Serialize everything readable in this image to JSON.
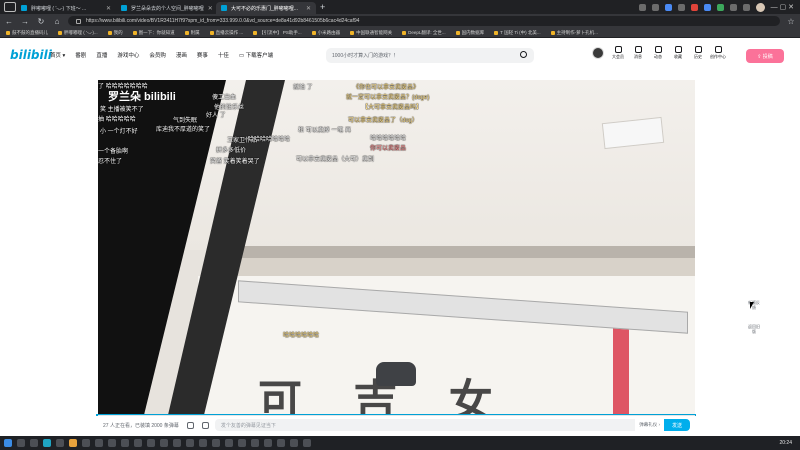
{
  "browser": {
    "tabs": [
      {
        "title": "胖嘟嘟哩 ( '-ᴗ-) 下班～ ...",
        "active": false
      },
      {
        "title": "罗兰朵朵去的个人空间_胖嘟嘟哩",
        "active": false
      },
      {
        "title": "大可不必的乐惠门_胖嘟嘟哩...",
        "active": true
      }
    ],
    "new_tab": "+",
    "url": "https://www.bilibili.com/video/BV1R3411H7f9?spm_id_from=333.999.0.0&vd_source=de8a41d92b8461505b6cac4d24caf94",
    "bookmarks": [
      "鼓不鼓的直播码儿",
      "胖嘟嘟哩 ( '-ᴗ-)...",
      "我的",
      "图一下：你就知道",
      "附属",
      "直播云操作 ...",
      "【引流中】 PS助手...",
      "小米路由器",
      "中国联通智能网关",
      "DeepL翻译: 全世...",
      "国内数据库",
      "T 国轻 Ti (中) 北美...",
      "主持制作-萝卜孔机..."
    ],
    "window_controls": "— ▢ ✕"
  },
  "bili": {
    "logo": "bilibili",
    "nav": [
      "首页 ▾",
      "番剧",
      "直播",
      "游戏中心",
      "会员购",
      "漫画",
      "赛事",
      "十佳",
      "▭ 下载客户端"
    ],
    "search_placeholder": "1000小时才算入门的游戏？！",
    "header_icons": [
      "大会员",
      "消息",
      "动态",
      "收藏",
      "历史",
      "创作中心"
    ],
    "upload_label": "⇪ 投稿"
  },
  "player": {
    "watermark": "罗兰朵 bilibili",
    "danmaku": [
      {
        "text": "了 哈哈哈哈哈哈哈",
        "style": ""
      },
      {
        "text": "笑 主播被笑不了",
        "style": ""
      },
      {
        "text": "抽 哈哈哈哈哈",
        "style": ""
      },
      {
        "text": "傻工出血",
        "style": ""
      },
      {
        "text": "他的弦乐丝",
        "style": ""
      },
      {
        "text": "好人 了",
        "style": ""
      },
      {
        "text": "气到失眠",
        "style": ""
      },
      {
        "text": "小 一个灯不好",
        "style": ""
      },
      {
        "text": "库迪我不厚道的笑了",
        "style": ""
      },
      {
        "text": "王家卫作品",
        "style": ""
      },
      {
        "text": "拼多多低价",
        "style": ""
      },
      {
        "text": "哈哈哈哈哈哈哈",
        "style": ""
      },
      {
        "text": "一个备胎啊",
        "style": ""
      },
      {
        "text": "忍不住了",
        "style": ""
      },
      {
        "text": "笑留 笑着笑着哭了",
        "style": ""
      },
      {
        "text": "《你也可以拿去卖废品》",
        "style": "ylw"
      },
      {
        "text": "【大可拿去卖废品吗】",
        "style": "ylw"
      },
      {
        "text": "就一定可以拿去卖废品？(doge)",
        "style": "ylw"
      },
      {
        "text": "可以拿去卖废品了（dog）",
        "style": "ylw"
      },
      {
        "text": "你可以卖废品",
        "style": "red"
      },
      {
        "text": "哈哈哈哈哈哈",
        "style": ""
      },
      {
        "text": "和 可以卖掉 一笔 再",
        "style": ""
      },
      {
        "text": "可以拿去卖废品（大可）卖到",
        "style": ""
      },
      {
        "text": "就怕 了",
        "style": ""
      },
      {
        "text": "哈哈哈哈哈哈",
        "style": "ylw"
      }
    ],
    "floor_text": "可 吉 女"
  },
  "sendbar": {
    "watching": "27 人正在看，已装填 2000 条弹幕",
    "input_placeholder": "发个友善的弹幕见证当下",
    "etiquette": "弹幕礼仪 ›",
    "send_label": "发送"
  },
  "side_float": [
    "新版反馈",
    "返回旧版"
  ],
  "taskbar": {
    "clock": "20:24"
  }
}
